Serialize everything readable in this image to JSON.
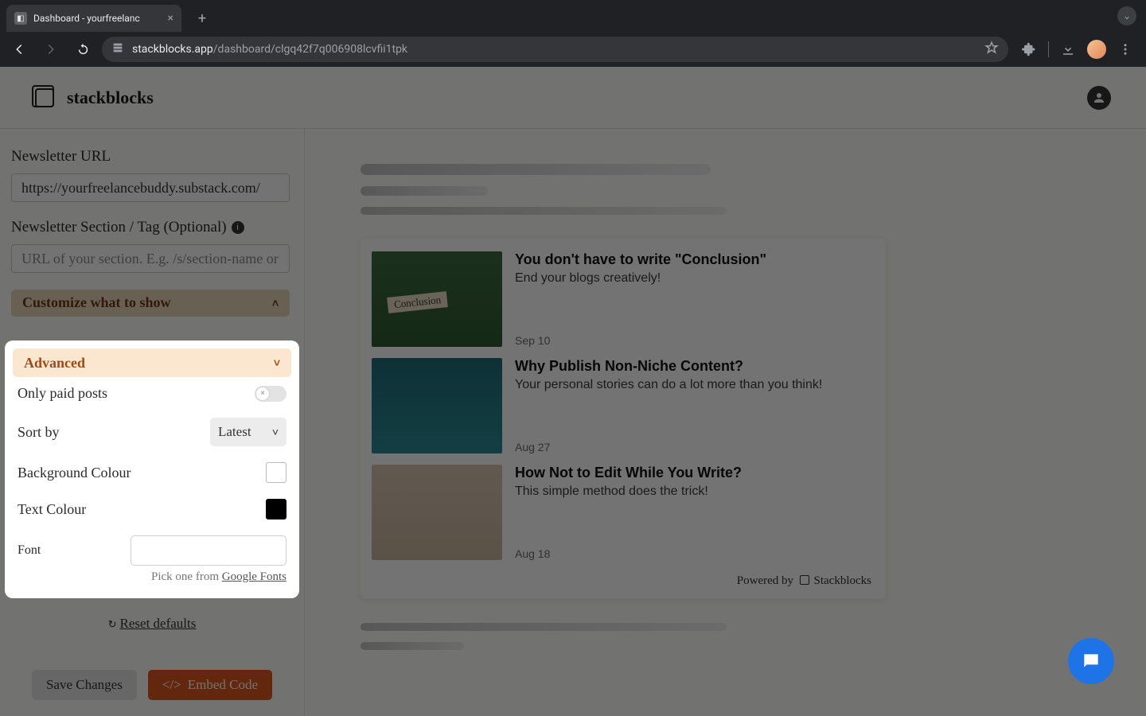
{
  "browser": {
    "tab_title": "Dashboard - yourfreelanc",
    "url_host": "stackblocks.app",
    "url_path": "/dashboard/clgq42f7q006908lcvfii1tpk"
  },
  "header": {
    "brand": "stackblocks"
  },
  "sidebar": {
    "newsletter_url_label": "Newsletter URL",
    "newsletter_url_value": "https://yourfreelancebuddy.substack.com/",
    "section_label": "Newsletter Section / Tag (Optional)",
    "section_placeholder": "URL of your section. E.g. /s/section-name or /t",
    "customize_label": "Customize what to show",
    "advanced": {
      "label": "Advanced",
      "only_paid_label": "Only paid posts",
      "sort_by_label": "Sort by",
      "sort_by_value": "Latest",
      "bg_colour_label": "Background Colour",
      "text_colour_label": "Text Colour",
      "font_label": "Font",
      "font_hint_prefix": "Pick one from ",
      "font_hint_link": "Google Fonts"
    },
    "reset_label": "Reset defaults",
    "save_label": "Save Changes",
    "embed_label": "Embed Code"
  },
  "preview": {
    "posts": [
      {
        "title": "You don't have to write \"Conclusion\"",
        "subtitle": "End your blogs creatively!",
        "date": "Sep 10"
      },
      {
        "title": "Why Publish Non-Niche Content?",
        "subtitle": "Your personal stories can do a lot more than you think!",
        "date": "Aug 27"
      },
      {
        "title": "How Not to Edit While You Write?",
        "subtitle": "This simple method does the trick!",
        "date": "Aug 18"
      }
    ],
    "powered_prefix": "Powered by",
    "powered_brand": "Stackblocks"
  }
}
